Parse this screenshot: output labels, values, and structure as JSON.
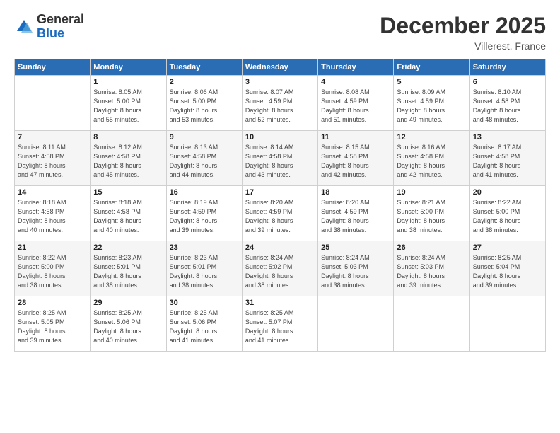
{
  "logo": {
    "general": "General",
    "blue": "Blue"
  },
  "header": {
    "title": "December 2025",
    "location": "Villerest, France"
  },
  "days_header": [
    "Sunday",
    "Monday",
    "Tuesday",
    "Wednesday",
    "Thursday",
    "Friday",
    "Saturday"
  ],
  "weeks": [
    [
      {
        "day": "",
        "sunrise": "",
        "sunset": "",
        "daylight": ""
      },
      {
        "day": "1",
        "sunrise": "Sunrise: 8:05 AM",
        "sunset": "Sunset: 5:00 PM",
        "daylight": "Daylight: 8 hours and 55 minutes."
      },
      {
        "day": "2",
        "sunrise": "Sunrise: 8:06 AM",
        "sunset": "Sunset: 5:00 PM",
        "daylight": "Daylight: 8 hours and 53 minutes."
      },
      {
        "day": "3",
        "sunrise": "Sunrise: 8:07 AM",
        "sunset": "Sunset: 4:59 PM",
        "daylight": "Daylight: 8 hours and 52 minutes."
      },
      {
        "day": "4",
        "sunrise": "Sunrise: 8:08 AM",
        "sunset": "Sunset: 4:59 PM",
        "daylight": "Daylight: 8 hours and 51 minutes."
      },
      {
        "day": "5",
        "sunrise": "Sunrise: 8:09 AM",
        "sunset": "Sunset: 4:59 PM",
        "daylight": "Daylight: 8 hours and 49 minutes."
      },
      {
        "day": "6",
        "sunrise": "Sunrise: 8:10 AM",
        "sunset": "Sunset: 4:58 PM",
        "daylight": "Daylight: 8 hours and 48 minutes."
      }
    ],
    [
      {
        "day": "7",
        "sunrise": "Sunrise: 8:11 AM",
        "sunset": "Sunset: 4:58 PM",
        "daylight": "Daylight: 8 hours and 47 minutes."
      },
      {
        "day": "8",
        "sunrise": "Sunrise: 8:12 AM",
        "sunset": "Sunset: 4:58 PM",
        "daylight": "Daylight: 8 hours and 45 minutes."
      },
      {
        "day": "9",
        "sunrise": "Sunrise: 8:13 AM",
        "sunset": "Sunset: 4:58 PM",
        "daylight": "Daylight: 8 hours and 44 minutes."
      },
      {
        "day": "10",
        "sunrise": "Sunrise: 8:14 AM",
        "sunset": "Sunset: 4:58 PM",
        "daylight": "Daylight: 8 hours and 43 minutes."
      },
      {
        "day": "11",
        "sunrise": "Sunrise: 8:15 AM",
        "sunset": "Sunset: 4:58 PM",
        "daylight": "Daylight: 8 hours and 42 minutes."
      },
      {
        "day": "12",
        "sunrise": "Sunrise: 8:16 AM",
        "sunset": "Sunset: 4:58 PM",
        "daylight": "Daylight: 8 hours and 42 minutes."
      },
      {
        "day": "13",
        "sunrise": "Sunrise: 8:17 AM",
        "sunset": "Sunset: 4:58 PM",
        "daylight": "Daylight: 8 hours and 41 minutes."
      }
    ],
    [
      {
        "day": "14",
        "sunrise": "Sunrise: 8:18 AM",
        "sunset": "Sunset: 4:58 PM",
        "daylight": "Daylight: 8 hours and 40 minutes."
      },
      {
        "day": "15",
        "sunrise": "Sunrise: 8:18 AM",
        "sunset": "Sunset: 4:58 PM",
        "daylight": "Daylight: 8 hours and 40 minutes."
      },
      {
        "day": "16",
        "sunrise": "Sunrise: 8:19 AM",
        "sunset": "Sunset: 4:59 PM",
        "daylight": "Daylight: 8 hours and 39 minutes."
      },
      {
        "day": "17",
        "sunrise": "Sunrise: 8:20 AM",
        "sunset": "Sunset: 4:59 PM",
        "daylight": "Daylight: 8 hours and 39 minutes."
      },
      {
        "day": "18",
        "sunrise": "Sunrise: 8:20 AM",
        "sunset": "Sunset: 4:59 PM",
        "daylight": "Daylight: 8 hours and 38 minutes."
      },
      {
        "day": "19",
        "sunrise": "Sunrise: 8:21 AM",
        "sunset": "Sunset: 5:00 PM",
        "daylight": "Daylight: 8 hours and 38 minutes."
      },
      {
        "day": "20",
        "sunrise": "Sunrise: 8:22 AM",
        "sunset": "Sunset: 5:00 PM",
        "daylight": "Daylight: 8 hours and 38 minutes."
      }
    ],
    [
      {
        "day": "21",
        "sunrise": "Sunrise: 8:22 AM",
        "sunset": "Sunset: 5:00 PM",
        "daylight": "Daylight: 8 hours and 38 minutes."
      },
      {
        "day": "22",
        "sunrise": "Sunrise: 8:23 AM",
        "sunset": "Sunset: 5:01 PM",
        "daylight": "Daylight: 8 hours and 38 minutes."
      },
      {
        "day": "23",
        "sunrise": "Sunrise: 8:23 AM",
        "sunset": "Sunset: 5:01 PM",
        "daylight": "Daylight: 8 hours and 38 minutes."
      },
      {
        "day": "24",
        "sunrise": "Sunrise: 8:24 AM",
        "sunset": "Sunset: 5:02 PM",
        "daylight": "Daylight: 8 hours and 38 minutes."
      },
      {
        "day": "25",
        "sunrise": "Sunrise: 8:24 AM",
        "sunset": "Sunset: 5:03 PM",
        "daylight": "Daylight: 8 hours and 38 minutes."
      },
      {
        "day": "26",
        "sunrise": "Sunrise: 8:24 AM",
        "sunset": "Sunset: 5:03 PM",
        "daylight": "Daylight: 8 hours and 39 minutes."
      },
      {
        "day": "27",
        "sunrise": "Sunrise: 8:25 AM",
        "sunset": "Sunset: 5:04 PM",
        "daylight": "Daylight: 8 hours and 39 minutes."
      }
    ],
    [
      {
        "day": "28",
        "sunrise": "Sunrise: 8:25 AM",
        "sunset": "Sunset: 5:05 PM",
        "daylight": "Daylight: 8 hours and 39 minutes."
      },
      {
        "day": "29",
        "sunrise": "Sunrise: 8:25 AM",
        "sunset": "Sunset: 5:06 PM",
        "daylight": "Daylight: 8 hours and 40 minutes."
      },
      {
        "day": "30",
        "sunrise": "Sunrise: 8:25 AM",
        "sunset": "Sunset: 5:06 PM",
        "daylight": "Daylight: 8 hours and 41 minutes."
      },
      {
        "day": "31",
        "sunrise": "Sunrise: 8:25 AM",
        "sunset": "Sunset: 5:07 PM",
        "daylight": "Daylight: 8 hours and 41 minutes."
      },
      {
        "day": "",
        "sunrise": "",
        "sunset": "",
        "daylight": ""
      },
      {
        "day": "",
        "sunrise": "",
        "sunset": "",
        "daylight": ""
      },
      {
        "day": "",
        "sunrise": "",
        "sunset": "",
        "daylight": ""
      }
    ]
  ]
}
